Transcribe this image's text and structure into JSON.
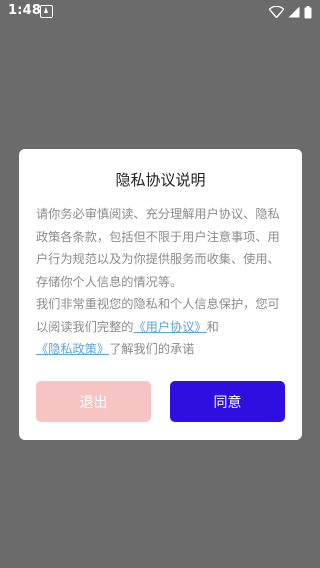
{
  "status_bar": {
    "time": "1:48",
    "icons": [
      "notification-icon",
      "wifi-icon",
      "signal-icon",
      "battery-icon"
    ]
  },
  "dialog": {
    "title": "隐私协议说明",
    "paragraph1": "请你务必审慎阅读、充分理解用户协议、隐私政策各条款，包括但不限于用户注意事项、用户行为规范以及为你提供服务而收集、使用、存储你个人信息的情况等。",
    "paragraph2_prefix": "我们非常重视您的隐私和个人信息保护，您可以阅读我们完整的",
    "user_agreement_link": "《用户协议》",
    "conjunction": "和",
    "privacy_policy_link": "《隐私政策》",
    "paragraph2_suffix": "了解我们的承诺",
    "exit_label": "退出",
    "agree_label": "同意"
  },
  "colors": {
    "overlay": "#6b6b6b",
    "link": "#5aa6d6",
    "exit_button": "#f7c4c4",
    "agree_button": "#2d0fe0"
  }
}
